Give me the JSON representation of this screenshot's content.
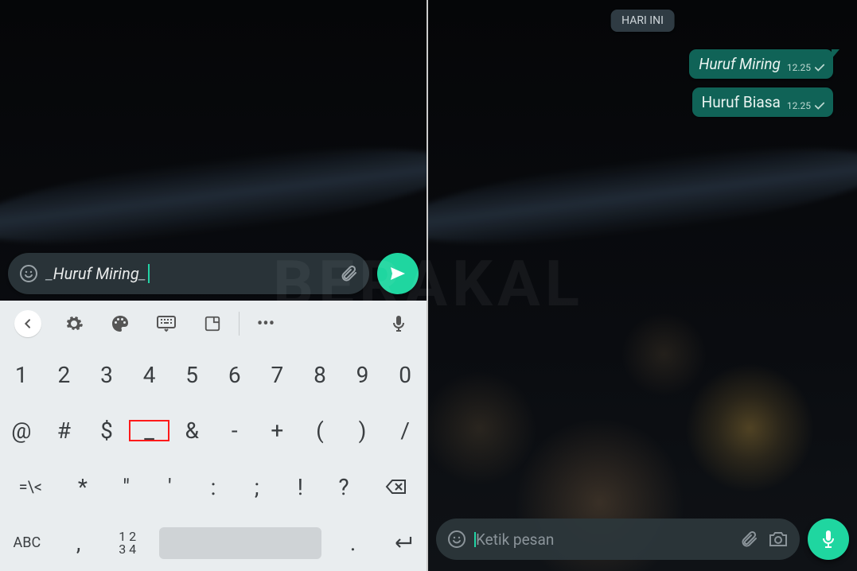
{
  "watermark": "BERAKAL",
  "left": {
    "compose": {
      "prefix": "_",
      "text": "Huruf Miring",
      "suffix": "_"
    },
    "keyboard": {
      "row1": [
        "1",
        "2",
        "3",
        "4",
        "5",
        "6",
        "7",
        "8",
        "9",
        "0"
      ],
      "row2": [
        "@",
        "#",
        "$",
        "_",
        "&",
        "-",
        "+",
        "(",
        ")",
        "/"
      ],
      "row3": [
        "=\\<",
        "*",
        "\"",
        "'",
        ":",
        ";",
        "!",
        "?"
      ],
      "row4": {
        "abc": "ABC",
        "comma": ",",
        "nums_top": "1 2",
        "nums_bottom": "3 4",
        "period": "."
      },
      "highlighted_key_index": {
        "row": 1,
        "col": 3
      }
    }
  },
  "right": {
    "day_chip": "HARI INI",
    "messages": [
      {
        "text": "Huruf Miring",
        "italic": true,
        "time": "12.25"
      },
      {
        "text": "Huruf Biasa",
        "italic": false,
        "time": "12.25"
      }
    ],
    "compose": {
      "placeholder": "Ketik pesan"
    }
  }
}
